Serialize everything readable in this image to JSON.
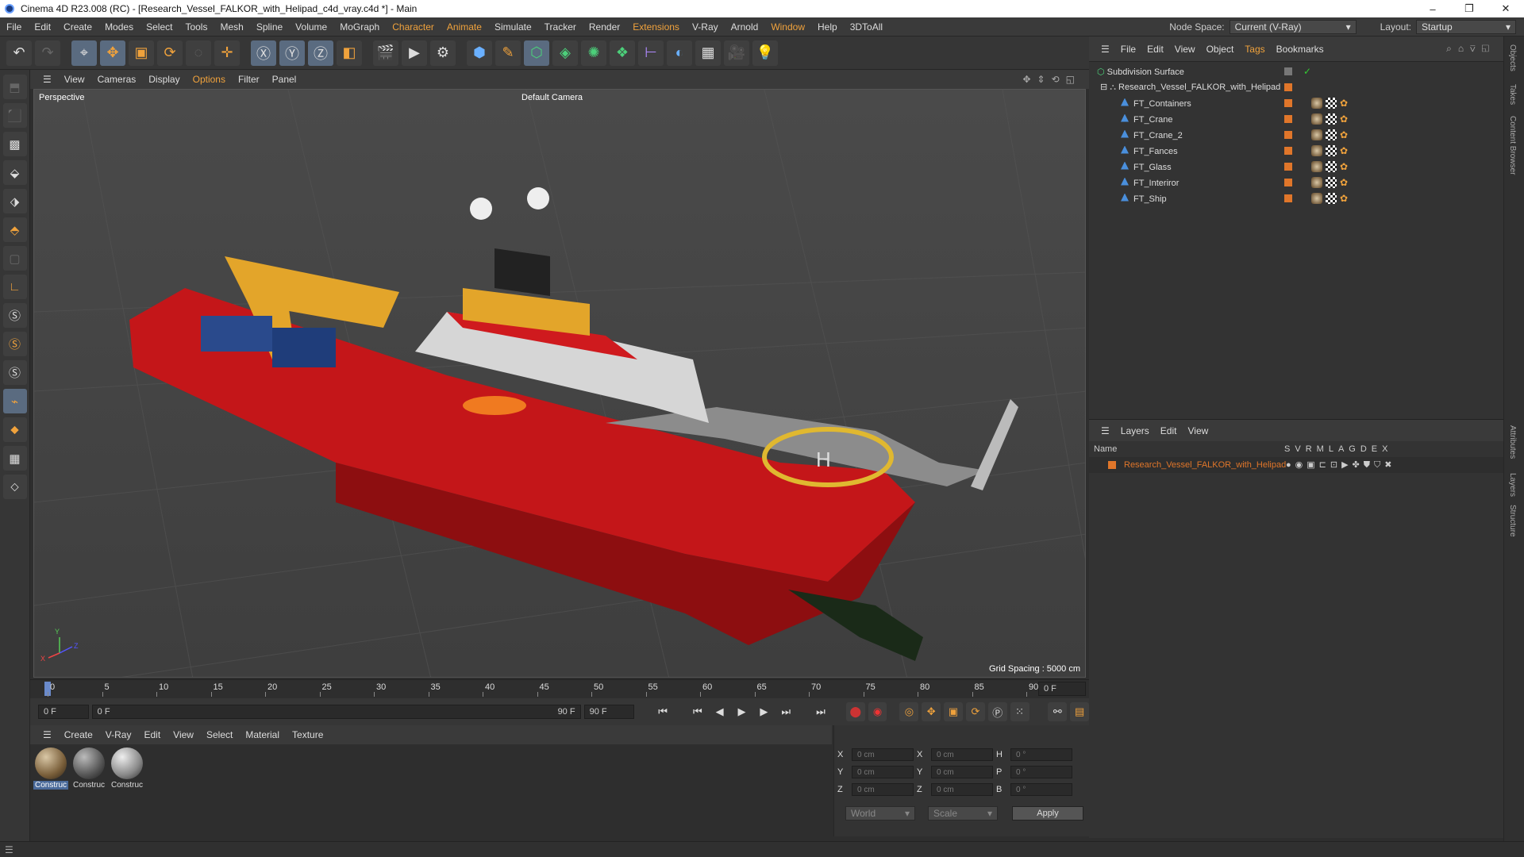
{
  "window": {
    "title": "Cinema 4D R23.008 (RC) - [Research_Vessel_FALKOR_with_Helipad_c4d_vray.c4d *] - Main",
    "min": "–",
    "max": "❐",
    "close": "✕"
  },
  "menu": {
    "items": [
      "File",
      "Edit",
      "Create",
      "Modes",
      "Select",
      "Tools",
      "Mesh",
      "Spline",
      "Volume",
      "MoGraph",
      "Character",
      "Animate",
      "Simulate",
      "Tracker",
      "Render",
      "Extensions",
      "V-Ray",
      "Arnold",
      "Window",
      "Help",
      "3DToAll"
    ],
    "node_space_label": "Node Space:",
    "node_space_value": "Current (V-Ray)",
    "layout_label": "Layout:",
    "layout_value": "Startup"
  },
  "viewport": {
    "menu": [
      "View",
      "Cameras",
      "Display",
      "Options",
      "Filter",
      "Panel"
    ],
    "label": "Perspective",
    "camera": "Default Camera",
    "grid_spacing": "Grid Spacing : 5000 cm",
    "axis_x": "X",
    "axis_y": "Y",
    "axis_z": "Z"
  },
  "timeline": {
    "ticks": [
      "0",
      "5",
      "10",
      "15",
      "20",
      "25",
      "30",
      "35",
      "40",
      "45",
      "50",
      "55",
      "60",
      "65",
      "70",
      "75",
      "80",
      "85",
      "90"
    ],
    "current_frame": "0 F"
  },
  "playback": {
    "start": "0 F",
    "start2": "0 F",
    "end1": "90 F",
    "end2": "90 F"
  },
  "materials": {
    "menu": [
      "Create",
      "V-Ray",
      "Edit",
      "View",
      "Select",
      "Material",
      "Texture"
    ],
    "items": [
      "Construc",
      "Construc",
      "Construc"
    ]
  },
  "coords": {
    "labels": [
      "X",
      "Y",
      "Z"
    ],
    "labels2": [
      "X",
      "Y",
      "Z"
    ],
    "labels3": [
      "H",
      "P",
      "B"
    ],
    "pos": [
      "0 cm",
      "0 cm",
      "0 cm"
    ],
    "size": [
      "0 cm",
      "0 cm",
      "0 cm"
    ],
    "rot": [
      "0 °",
      "0 °",
      "0 °"
    ],
    "world": "World",
    "scale": "Scale",
    "apply": "Apply"
  },
  "objects": {
    "menu": [
      "File",
      "Edit",
      "View",
      "Object",
      "Tags",
      "Bookmarks"
    ],
    "root": "Subdivision Surface",
    "group": "Research_Vessel_FALKOR_with_Helipad",
    "children": [
      "FT_Containers",
      "FT_Crane",
      "FT_Crane_2",
      "FT_Fances",
      "FT_Glass",
      "FT_Interiror",
      "FT_Ship"
    ]
  },
  "layers": {
    "menu": [
      "Layers",
      "Edit",
      "View"
    ],
    "name_col": "Name",
    "cols": [
      "S",
      "V",
      "R",
      "M",
      "L",
      "A",
      "G",
      "D",
      "E",
      "X"
    ],
    "row": "Research_Vessel_FALKOR_with_Helipad"
  },
  "side_tabs": [
    "Objects",
    "Takes",
    "Content Browser",
    "Attributes",
    "Layers",
    "Structure"
  ],
  "colors": {
    "accent": "#f0a23c",
    "layer": "#e0762a",
    "hull": "#c0161a"
  }
}
